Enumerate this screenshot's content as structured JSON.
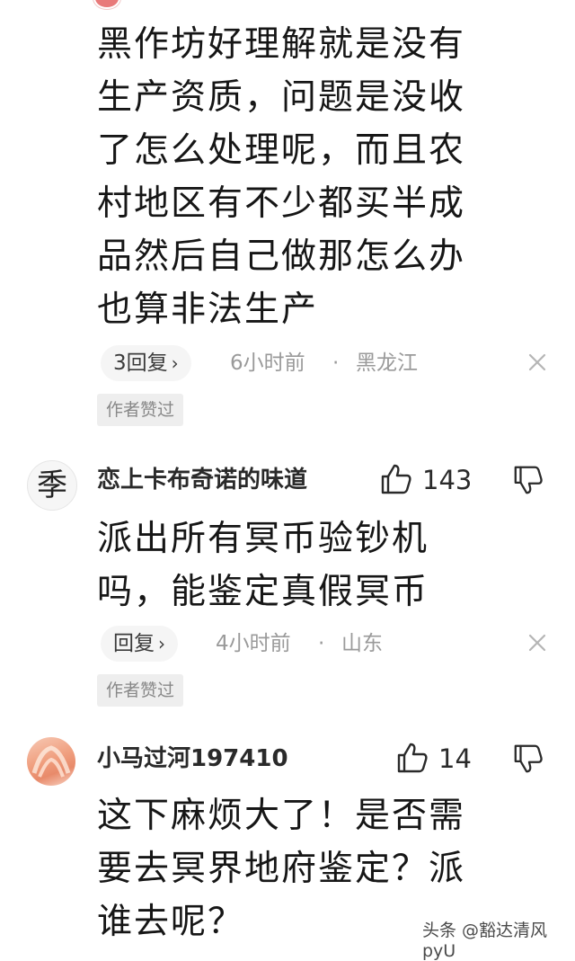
{
  "comments": [
    {
      "body": "黑作坊好理解就是没有\n生产资质，问题是没收\n了怎么处理呢，而且农\n村地区有不少都买半成\n品然后自己做那怎么办\n也算非法生产",
      "reply_label": "3回复",
      "time": "6小时前",
      "separator": "·",
      "region": "黑龙江",
      "badge": "作者赞过"
    },
    {
      "username": "恋上卡布奇诺的味道",
      "avatar_text": "季",
      "likes": "143",
      "body": "派出所有冥币验钞机\n吗，能鉴定真假冥币",
      "reply_label": "回复",
      "time": "4小时前",
      "separator": "·",
      "region": "山东",
      "badge": "作者赞过"
    },
    {
      "username": "小马过河197410",
      "likes": "14",
      "body": "这下麻烦大了！是否需\n要去冥界地府鉴定？派\n谁去呢？"
    }
  ],
  "watermark": "头条 @豁达清风pyU",
  "colors": {
    "text": "#161616",
    "meta": "#9a9a9a",
    "badge_bg": "#eeeeee",
    "reply_bg": "#f5f5f5"
  },
  "icons": [
    "close-icon",
    "thumbs-up-icon",
    "thumbs-down-icon",
    "chevron-right-icon"
  ]
}
